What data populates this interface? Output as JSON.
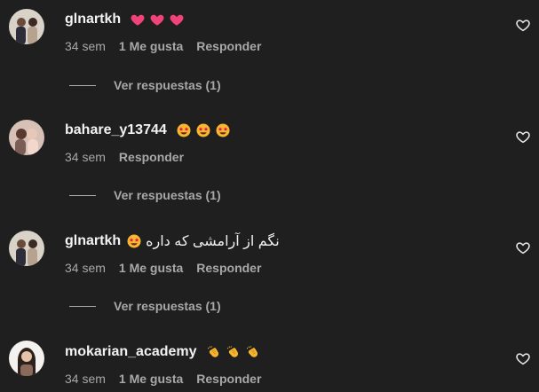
{
  "comments": [
    {
      "username": "glnartkh",
      "text": "",
      "emojis": [
        "pink-heart-icon",
        "pink-heart-icon",
        "pink-heart-icon"
      ],
      "time": "34 sem",
      "likes": "1 Me gusta",
      "reply": "Responder",
      "view_replies": "Ver respuestas (1)"
    },
    {
      "username": "bahare_y13744",
      "text": "",
      "emojis": [
        "star-struck-icon",
        "star-struck-icon",
        "star-struck-icon"
      ],
      "time": "34 sem",
      "likes": "",
      "reply": "Responder",
      "view_replies": "Ver respuestas (1)"
    },
    {
      "username": "glnartkh",
      "text": "نگم از آرامشی که داره",
      "emojis": [
        "star-struck-icon"
      ],
      "time": "34 sem",
      "likes": "1 Me gusta",
      "reply": "Responder",
      "view_replies": "Ver respuestas (1)"
    },
    {
      "username": "mokarian_academy",
      "text": "",
      "emojis": [
        "clapping-hands-icon",
        "clapping-hands-icon",
        "clapping-hands-icon"
      ],
      "time": "34 sem",
      "likes": "1 Me gusta",
      "reply": "Responder",
      "view_replies": ""
    }
  ],
  "colors": {
    "background": "#1f1f1f",
    "text_primary": "#f2f2f2",
    "text_secondary": "#a8a8a8",
    "pink_heart": "#f0437a",
    "emoji_face": "#f7b731",
    "emoji_eye": "#e6194b"
  }
}
